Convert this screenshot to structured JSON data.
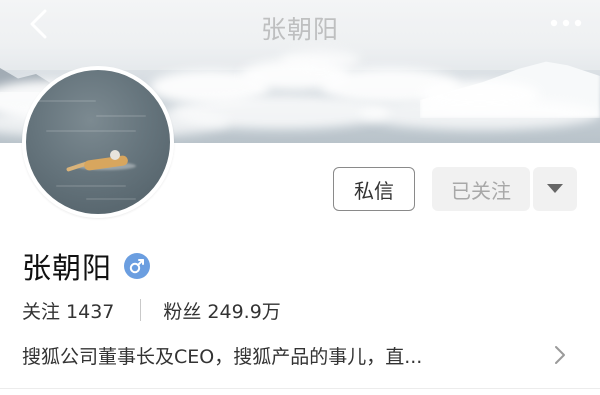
{
  "header": {
    "title": "张朝阳",
    "back_icon": "chevron-left-icon",
    "more_icon": "more-dots-icon"
  },
  "profile": {
    "name": "张朝阳",
    "gender_icon": "male-icon",
    "gender_color": "#6b9ee0",
    "following_label": "关注",
    "following_count": "1437",
    "followers_label": "粉丝",
    "followers_count": "249.9万",
    "bio": "搜狐公司董事长及CEO，搜狐产品的事儿，直..."
  },
  "actions": {
    "message_label": "私信",
    "followed_label": "已关注",
    "dropdown_icon": "caret-down-icon"
  },
  "colors": {
    "accent": "#6b9ee0",
    "followed_bg": "#f1f1f1",
    "followed_text": "#a8a8a8"
  }
}
